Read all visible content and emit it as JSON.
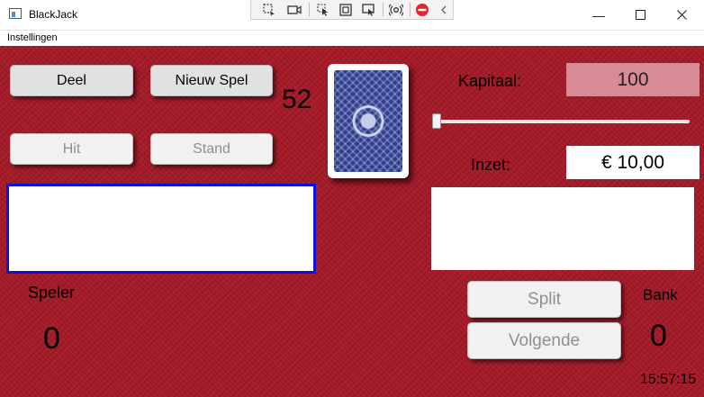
{
  "window": {
    "title": "BlackJack",
    "minimize_glyph": "—",
    "maximize_glyph": "☐",
    "close_glyph": "✕"
  },
  "recording_toolbar": {
    "icons": [
      "region-select-icon",
      "video-camera-icon",
      "pointer-icon",
      "window-select-icon",
      "fullscreen-select-icon",
      "audio-icon",
      "stop-record-icon",
      "collapse-chevron-icon"
    ]
  },
  "menu": {
    "settings_label": "Instellingen"
  },
  "game": {
    "deal_label": "Deel",
    "new_game_label": "Nieuw Spel",
    "hit_label": "Hit",
    "stand_label": "Stand",
    "deck_count": "52",
    "capital_label": "Kapitaal:",
    "capital_value": "100",
    "bet_label": "Inzet:",
    "bet_value": "€ 10,00",
    "bet_fraction": 0.0,
    "player_label": "Speler",
    "player_score": "0",
    "split_label": "Split",
    "next_label": "Volgende",
    "bank_label": "Bank",
    "bank_score": "0",
    "clock": "15:57:15"
  },
  "colors": {
    "felt": "#a51826",
    "capital_box": "#d98b95",
    "player_box_border": "#0a14d6",
    "card_back": "#2f3d8f"
  }
}
